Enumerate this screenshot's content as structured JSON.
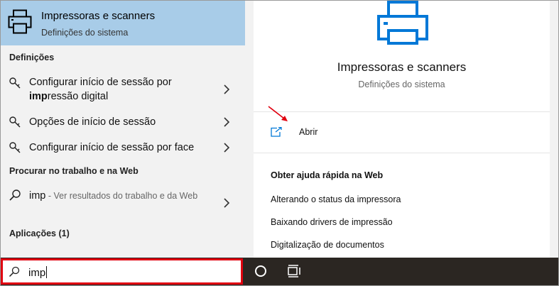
{
  "best_match": {
    "title": "Impressoras e scanners",
    "subtitle": "Definições do sistema",
    "icon": "printer-icon"
  },
  "settings_section": {
    "heading": "Definições",
    "items": [
      {
        "prefix": "Configurar início de sessão por ",
        "bold": "imp",
        "suffix": "ressão digital",
        "icon": "key-icon"
      },
      {
        "label": "Opções de início de sessão",
        "icon": "key-icon"
      },
      {
        "label": "Configurar início de sessão por face",
        "icon": "key-icon"
      }
    ]
  },
  "web_section": {
    "heading": "Procurar no trabalho e na Web",
    "query": "imp",
    "description": " - Ver resultados do trabalho e da Web",
    "icon": "search-icon"
  },
  "apps_section": {
    "heading": "Aplicações (1)"
  },
  "detail": {
    "title": "Impressoras e scanners",
    "subtitle": "Definições do sistema",
    "open_label": "Abrir",
    "help_heading": "Obter ajuda rápida na Web",
    "help_links": [
      "Alterando o status da impressora",
      "Baixando drivers de impressão",
      "Digitalização de documentos"
    ]
  },
  "search": {
    "value": "imp"
  },
  "colors": {
    "selected_bg": "#a8cce8",
    "accent": "#0078d7",
    "highlight_border": "#e0000f",
    "taskbar": "#2b2622"
  }
}
